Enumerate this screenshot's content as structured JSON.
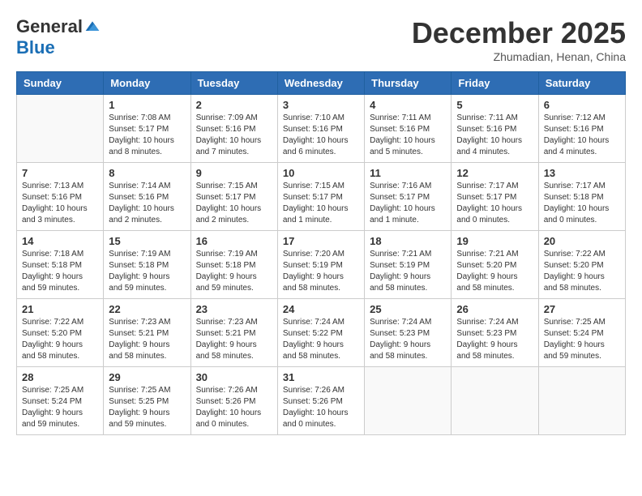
{
  "logo": {
    "general": "General",
    "blue": "Blue"
  },
  "header": {
    "month": "December 2025",
    "location": "Zhumadian, Henan, China"
  },
  "weekdays": [
    "Sunday",
    "Monday",
    "Tuesday",
    "Wednesday",
    "Thursday",
    "Friday",
    "Saturday"
  ],
  "weeks": [
    [
      {
        "day": "",
        "sunrise": "",
        "sunset": "",
        "daylight": ""
      },
      {
        "day": "1",
        "sunrise": "Sunrise: 7:08 AM",
        "sunset": "Sunset: 5:17 PM",
        "daylight": "Daylight: 10 hours and 8 minutes."
      },
      {
        "day": "2",
        "sunrise": "Sunrise: 7:09 AM",
        "sunset": "Sunset: 5:16 PM",
        "daylight": "Daylight: 10 hours and 7 minutes."
      },
      {
        "day": "3",
        "sunrise": "Sunrise: 7:10 AM",
        "sunset": "Sunset: 5:16 PM",
        "daylight": "Daylight: 10 hours and 6 minutes."
      },
      {
        "day": "4",
        "sunrise": "Sunrise: 7:11 AM",
        "sunset": "Sunset: 5:16 PM",
        "daylight": "Daylight: 10 hours and 5 minutes."
      },
      {
        "day": "5",
        "sunrise": "Sunrise: 7:11 AM",
        "sunset": "Sunset: 5:16 PM",
        "daylight": "Daylight: 10 hours and 4 minutes."
      },
      {
        "day": "6",
        "sunrise": "Sunrise: 7:12 AM",
        "sunset": "Sunset: 5:16 PM",
        "daylight": "Daylight: 10 hours and 4 minutes."
      }
    ],
    [
      {
        "day": "7",
        "sunrise": "Sunrise: 7:13 AM",
        "sunset": "Sunset: 5:16 PM",
        "daylight": "Daylight: 10 hours and 3 minutes."
      },
      {
        "day": "8",
        "sunrise": "Sunrise: 7:14 AM",
        "sunset": "Sunset: 5:16 PM",
        "daylight": "Daylight: 10 hours and 2 minutes."
      },
      {
        "day": "9",
        "sunrise": "Sunrise: 7:15 AM",
        "sunset": "Sunset: 5:17 PM",
        "daylight": "Daylight: 10 hours and 2 minutes."
      },
      {
        "day": "10",
        "sunrise": "Sunrise: 7:15 AM",
        "sunset": "Sunset: 5:17 PM",
        "daylight": "Daylight: 10 hours and 1 minute."
      },
      {
        "day": "11",
        "sunrise": "Sunrise: 7:16 AM",
        "sunset": "Sunset: 5:17 PM",
        "daylight": "Daylight: 10 hours and 1 minute."
      },
      {
        "day": "12",
        "sunrise": "Sunrise: 7:17 AM",
        "sunset": "Sunset: 5:17 PM",
        "daylight": "Daylight: 10 hours and 0 minutes."
      },
      {
        "day": "13",
        "sunrise": "Sunrise: 7:17 AM",
        "sunset": "Sunset: 5:18 PM",
        "daylight": "Daylight: 10 hours and 0 minutes."
      }
    ],
    [
      {
        "day": "14",
        "sunrise": "Sunrise: 7:18 AM",
        "sunset": "Sunset: 5:18 PM",
        "daylight": "Daylight: 9 hours and 59 minutes."
      },
      {
        "day": "15",
        "sunrise": "Sunrise: 7:19 AM",
        "sunset": "Sunset: 5:18 PM",
        "daylight": "Daylight: 9 hours and 59 minutes."
      },
      {
        "day": "16",
        "sunrise": "Sunrise: 7:19 AM",
        "sunset": "Sunset: 5:18 PM",
        "daylight": "Daylight: 9 hours and 59 minutes."
      },
      {
        "day": "17",
        "sunrise": "Sunrise: 7:20 AM",
        "sunset": "Sunset: 5:19 PM",
        "daylight": "Daylight: 9 hours and 58 minutes."
      },
      {
        "day": "18",
        "sunrise": "Sunrise: 7:21 AM",
        "sunset": "Sunset: 5:19 PM",
        "daylight": "Daylight: 9 hours and 58 minutes."
      },
      {
        "day": "19",
        "sunrise": "Sunrise: 7:21 AM",
        "sunset": "Sunset: 5:20 PM",
        "daylight": "Daylight: 9 hours and 58 minutes."
      },
      {
        "day": "20",
        "sunrise": "Sunrise: 7:22 AM",
        "sunset": "Sunset: 5:20 PM",
        "daylight": "Daylight: 9 hours and 58 minutes."
      }
    ],
    [
      {
        "day": "21",
        "sunrise": "Sunrise: 7:22 AM",
        "sunset": "Sunset: 5:20 PM",
        "daylight": "Daylight: 9 hours and 58 minutes."
      },
      {
        "day": "22",
        "sunrise": "Sunrise: 7:23 AM",
        "sunset": "Sunset: 5:21 PM",
        "daylight": "Daylight: 9 hours and 58 minutes."
      },
      {
        "day": "23",
        "sunrise": "Sunrise: 7:23 AM",
        "sunset": "Sunset: 5:21 PM",
        "daylight": "Daylight: 9 hours and 58 minutes."
      },
      {
        "day": "24",
        "sunrise": "Sunrise: 7:24 AM",
        "sunset": "Sunset: 5:22 PM",
        "daylight": "Daylight: 9 hours and 58 minutes."
      },
      {
        "day": "25",
        "sunrise": "Sunrise: 7:24 AM",
        "sunset": "Sunset: 5:23 PM",
        "daylight": "Daylight: 9 hours and 58 minutes."
      },
      {
        "day": "26",
        "sunrise": "Sunrise: 7:24 AM",
        "sunset": "Sunset: 5:23 PM",
        "daylight": "Daylight: 9 hours and 58 minutes."
      },
      {
        "day": "27",
        "sunrise": "Sunrise: 7:25 AM",
        "sunset": "Sunset: 5:24 PM",
        "daylight": "Daylight: 9 hours and 59 minutes."
      }
    ],
    [
      {
        "day": "28",
        "sunrise": "Sunrise: 7:25 AM",
        "sunset": "Sunset: 5:24 PM",
        "daylight": "Daylight: 9 hours and 59 minutes."
      },
      {
        "day": "29",
        "sunrise": "Sunrise: 7:25 AM",
        "sunset": "Sunset: 5:25 PM",
        "daylight": "Daylight: 9 hours and 59 minutes."
      },
      {
        "day": "30",
        "sunrise": "Sunrise: 7:26 AM",
        "sunset": "Sunset: 5:26 PM",
        "daylight": "Daylight: 10 hours and 0 minutes."
      },
      {
        "day": "31",
        "sunrise": "Sunrise: 7:26 AM",
        "sunset": "Sunset: 5:26 PM",
        "daylight": "Daylight: 10 hours and 0 minutes."
      },
      {
        "day": "",
        "sunrise": "",
        "sunset": "",
        "daylight": ""
      },
      {
        "day": "",
        "sunrise": "",
        "sunset": "",
        "daylight": ""
      },
      {
        "day": "",
        "sunrise": "",
        "sunset": "",
        "daylight": ""
      }
    ]
  ]
}
